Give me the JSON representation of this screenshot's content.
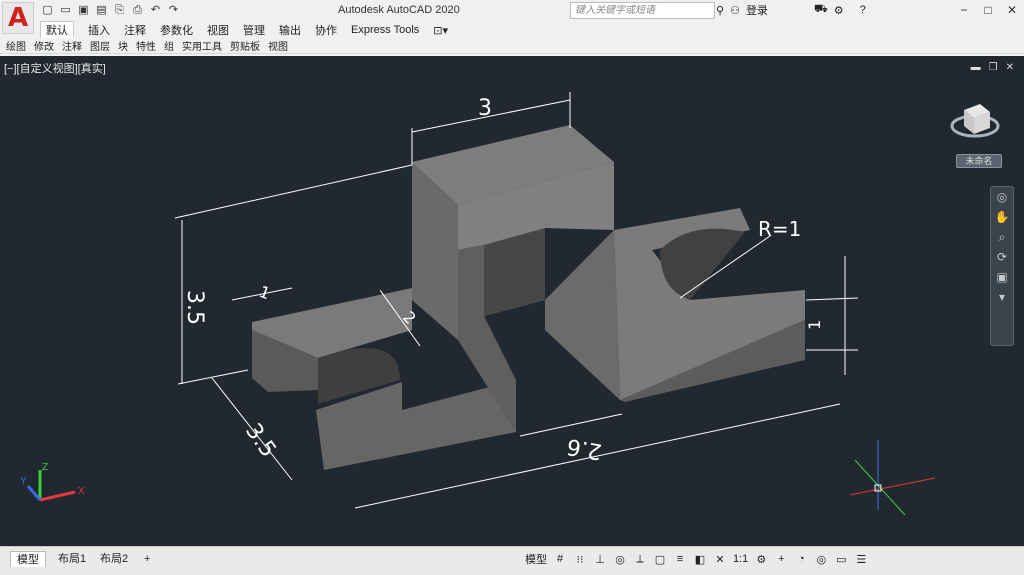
{
  "app": {
    "logo": "A",
    "title": "Autodesk AutoCAD 2020",
    "search_placeholder": "键入关键字或短语",
    "login_label": "登录"
  },
  "qat_icons": [
    "new-icon",
    "open-icon",
    "save-icon",
    "saveas-icon",
    "web-icon",
    "plot-icon",
    "undo-icon",
    "redo-icon"
  ],
  "ribbon": {
    "tabs": [
      "默认",
      "插入",
      "注释",
      "参数化",
      "视图",
      "管理",
      "输出",
      "协作",
      "Express Tools"
    ],
    "panels": [
      "绘图",
      "修改",
      "注释",
      "图层",
      "块",
      "特性",
      "组",
      "实用工具",
      "剪贴板",
      "视图"
    ]
  },
  "viewport": {
    "label": "[−][自定义视图][真实]",
    "wcs_label": "未命名",
    "background": "#212830"
  },
  "drawing": {
    "dims": [
      "3",
      "3.5",
      "3.5",
      "1",
      "2",
      "R=1",
      "1",
      "2.6"
    ]
  },
  "layout_tabs": [
    "模型",
    "布局1",
    "布局2",
    "+"
  ],
  "status": {
    "model_label": "模型",
    "scale": "1:1"
  }
}
